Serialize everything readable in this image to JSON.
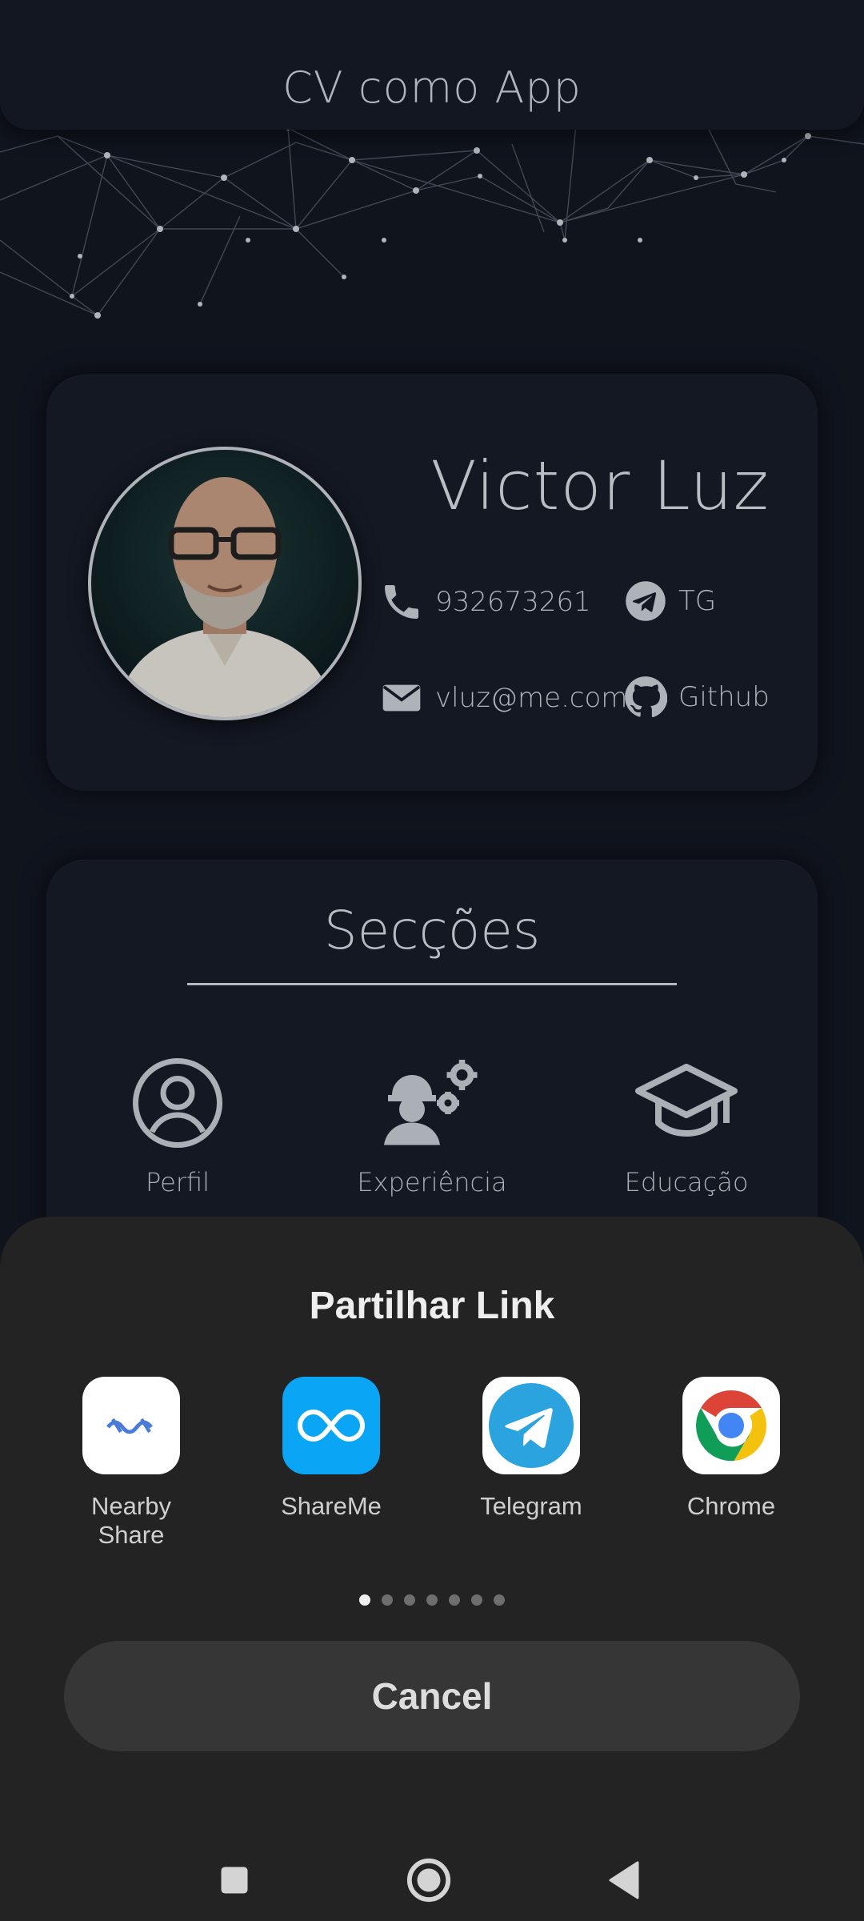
{
  "header": {
    "title": "CV como App"
  },
  "profile": {
    "name": "Victor Luz",
    "phone": "932673261",
    "telegram_label": "TG",
    "email": "vluz@me.com",
    "github_label": "Github"
  },
  "sections": {
    "title": "Secções",
    "items": [
      {
        "label": "Perfil",
        "icon": "person-circle-icon"
      },
      {
        "label": "Experiência",
        "icon": "worker-gears-icon"
      },
      {
        "label": "Educação",
        "icon": "graduation-cap-icon"
      }
    ]
  },
  "share_sheet": {
    "title": "Partilhar Link",
    "apps": [
      {
        "label": "Nearby\nShare",
        "icon": "nearby-share-icon"
      },
      {
        "label": "ShareMe",
        "icon": "shareme-icon"
      },
      {
        "label": "Telegram",
        "icon": "telegram-icon"
      },
      {
        "label": "Chrome",
        "icon": "chrome-icon"
      }
    ],
    "page_count": 7,
    "active_page": 1,
    "cancel_label": "Cancel"
  },
  "colors": {
    "background": "#121722",
    "card": "#171c28",
    "sheet": "#232323",
    "shareme_blue": "#0aa6f5",
    "telegram_blue": "#2aa3df"
  }
}
